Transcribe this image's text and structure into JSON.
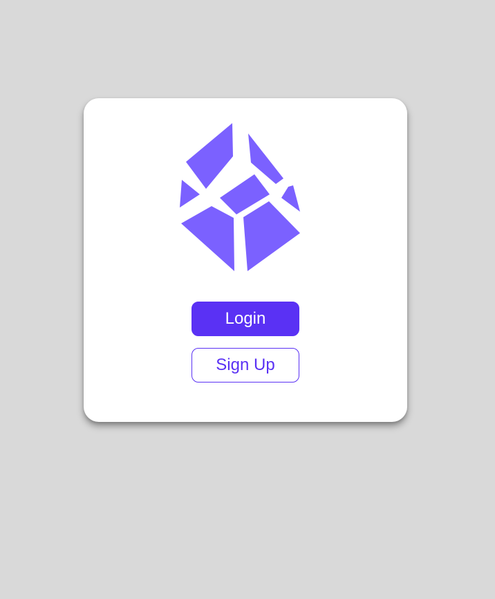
{
  "colors": {
    "background": "#d9d9d9",
    "card": "#ffffff",
    "accent": "#5a31f4",
    "logo": "#7b61ff"
  },
  "logo": {
    "icon": "cube-logo-icon"
  },
  "actions": {
    "login_label": "Login",
    "signup_label": "Sign Up"
  }
}
